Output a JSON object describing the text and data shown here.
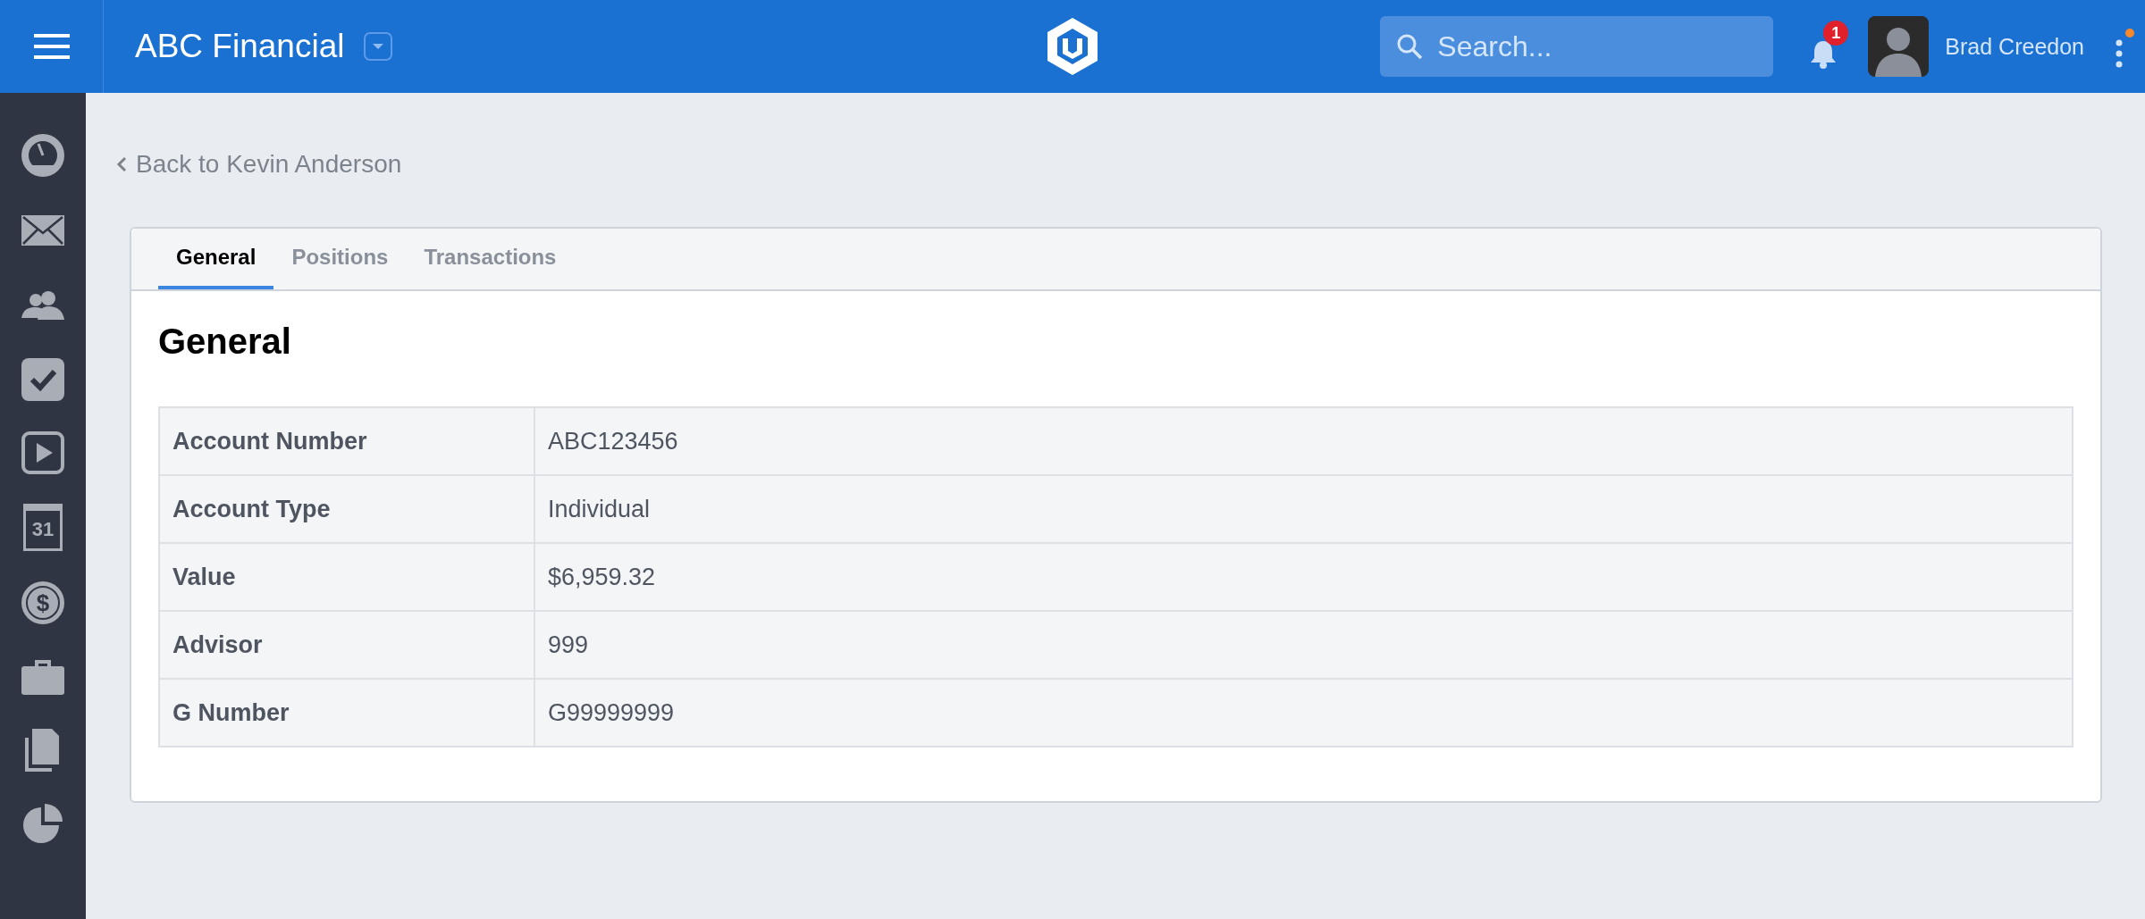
{
  "header": {
    "title": "ABC Financial",
    "search": {
      "placeholder": "Search..."
    },
    "notifications": {
      "count": "1"
    },
    "user": {
      "name": "Brad Creedon"
    }
  },
  "sidebar": {
    "items": [
      {
        "kind": "dashboard"
      },
      {
        "kind": "mail"
      },
      {
        "kind": "contacts"
      },
      {
        "kind": "tasks"
      },
      {
        "kind": "video"
      },
      {
        "kind": "calendar",
        "text": "31"
      },
      {
        "kind": "money",
        "text": "$"
      },
      {
        "kind": "briefcase"
      },
      {
        "kind": "documents"
      },
      {
        "kind": "reports"
      }
    ]
  },
  "back_link": "Back to Kevin Anderson",
  "tabs": [
    {
      "label": "General",
      "selected": true
    },
    {
      "label": "Positions",
      "selected": false
    },
    {
      "label": "Transactions",
      "selected": false
    }
  ],
  "section_title": "General",
  "table": {
    "rows": [
      {
        "label": "Account Number",
        "value": "ABC123456"
      },
      {
        "label": "Account Type",
        "value": "Individual"
      },
      {
        "label": "Value",
        "value": "$6,959.32"
      },
      {
        "label": "Advisor",
        "value": "999"
      },
      {
        "label": "G Number",
        "value": "G99999999"
      }
    ]
  }
}
